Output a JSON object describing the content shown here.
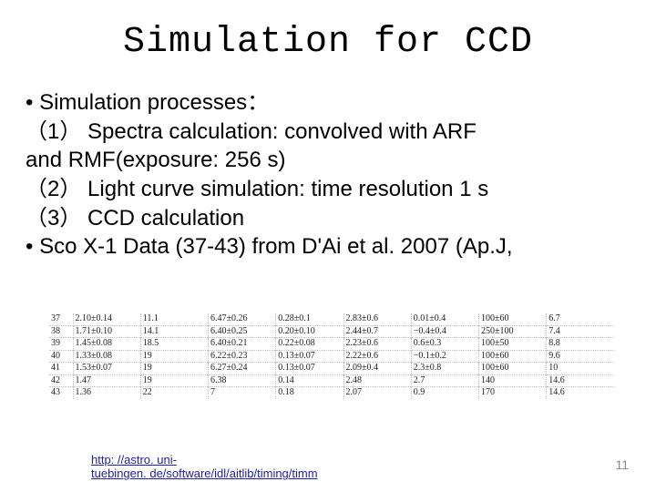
{
  "title": "Simulation for CCD",
  "body": {
    "line1": "•  Simulation processes：",
    "line2": "（1）  Spectra calculation:  convolved with ARF",
    "line3": "and RMF(exposure: 256 s)",
    "line4": "（2） Light curve simulation: time resolution 1 s",
    "line5": "（3） CCD calculation",
    "line6": "•  Sco X-1 Data (37-43) from D'Ai et al. 2007 (Ap.J,"
  },
  "table": {
    "rows": [
      "37",
      "38",
      "39",
      "40",
      "41",
      "42",
      "43"
    ],
    "cells": [
      [
        "2.10±0.14",
        "11.1",
        "6.47±0.26",
        "0.28±0.1",
        "2.83±0.6",
        "0.01±0.4",
        "100±60",
        "6.7"
      ],
      [
        "1.71±0.10",
        "14.1",
        "6.40±0.25",
        "0.20±0.10",
        "2.44±0.7",
        "−0.4±0.4",
        "250±100",
        "7.4"
      ],
      [
        "1.45±0.08",
        "18.5",
        "6.40±0.21",
        "0.22±0.08",
        "2.23±0.6",
        "0.6±0.3",
        "100±50",
        "8.8"
      ],
      [
        "1.33±0.08",
        "19",
        "6.22±0.23",
        "0.13±0.07",
        "2.22±0.6",
        "−0.1±0.2",
        "100±60",
        "9.6"
      ],
      [
        "1.53±0.07",
        "19",
        "6.27±0.24",
        "0.13±0.07",
        "2.09±0.4",
        "2.3±0.8",
        "100±60",
        "10"
      ],
      [
        "1.47",
        "19",
        "6.38",
        "0.14",
        "2.48",
        "2.7",
        "140",
        "14.6"
      ],
      [
        "1.36",
        "22",
        "7",
        "0.18",
        "2.07",
        "0.9",
        "170",
        "14.6"
      ]
    ]
  },
  "link": {
    "line1": "http: //astro. uni-",
    "line2": "tuebingen. de/software/idl/aitlib/timing/timm"
  },
  "page_number": "11"
}
